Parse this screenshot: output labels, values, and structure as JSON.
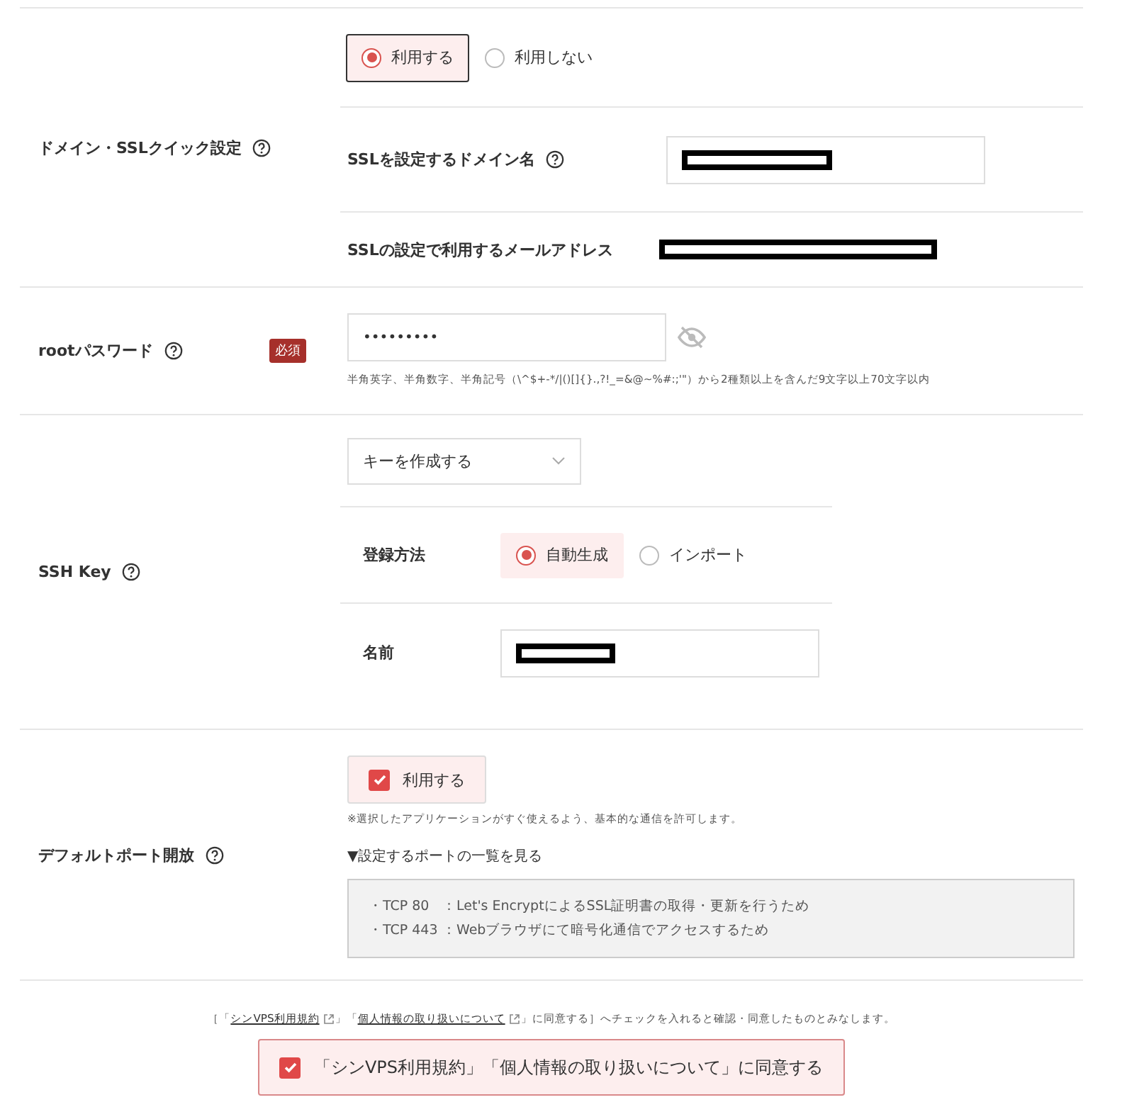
{
  "ssl_quick": {
    "label": "ドメイン・SSLクイック設定",
    "help": true,
    "options": [
      {
        "label": "利用する",
        "selected": true
      },
      {
        "label": "利用しない",
        "selected": false
      }
    ],
    "domain": {
      "label": "SSLを設定するドメイン名",
      "help": true,
      "redacted": true
    },
    "email": {
      "label": "SSLの設定で利用するメールアドレス",
      "help": false,
      "redacted": true
    }
  },
  "root_password": {
    "label": "rootパスワード",
    "help": true,
    "badge": "必須",
    "value": "•••••••••",
    "hint": "半角英字、半角数字、半角記号（\\^$+-*/|()[]{}.,?!_=&@~%#:;'\"）から2種類以上を含んだ9文字以上70文字以内"
  },
  "ssh_key": {
    "label": "SSH Key",
    "help": true,
    "select": "キーを作成する",
    "method": {
      "label": "登録方法",
      "options": [
        {
          "label": "自動生成",
          "selected": true
        },
        {
          "label": "インポート",
          "selected": false
        }
      ]
    },
    "name": {
      "label": "名前",
      "redacted": true
    }
  },
  "default_ports": {
    "label": "デフォルトポート開放",
    "help": true,
    "checkbox": {
      "label": "利用する",
      "checked": true
    },
    "note": "※選択したアプリケーションがすぐ使えるよう、基本的な通信を許可します。",
    "toggle": "▼設定するポートの一覧を見る",
    "ports": [
      {
        "port": "・TCP 80",
        "desc": "：Let's EncryptによるSSL証明書の取得・更新を行うため"
      },
      {
        "port": "・TCP 443",
        "desc": "：Webブラウザにて暗号化通信でアクセスするため"
      }
    ]
  },
  "agreement": {
    "notice": [
      {
        "kind": "text",
        "text": "［「"
      },
      {
        "kind": "link",
        "text": "シンVPS利用規約"
      },
      {
        "kind": "text",
        "text": "」「"
      },
      {
        "kind": "link",
        "text": "個人情報の取り扱いについて"
      },
      {
        "kind": "text",
        "text": "」に同意する］へチェックを入れると確認・同意したものとみなします。"
      }
    ],
    "checkbox": {
      "label": "「シンVPS利用規約」「個人情報の取り扱いについて」に同意する",
      "checked": true
    }
  }
}
